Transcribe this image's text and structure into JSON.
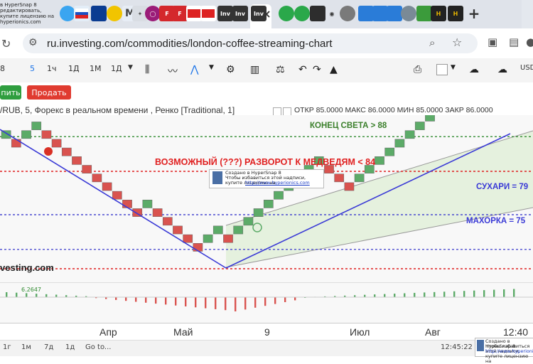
{
  "browser": {
    "hypersnap_note": [
      "в HyperSnap 8",
      "редактировать, купите лицензию на",
      "hyperionics.com"
    ],
    "tab_badges": [
      "F",
      "F",
      "Inv",
      "Inv",
      "Inv",
      "H",
      "H"
    ],
    "address": "ru.investing.com/commodities/london-coffee-streaming-chart"
  },
  "toolbar": {
    "interval_fragment": "8",
    "active_interval": "5",
    "intervals": [
      "1ч",
      "1Д",
      "1М",
      "1Д"
    ],
    "currency_fragment": "USD"
  },
  "orders": {
    "buy_label": "пить",
    "sell_label": "Продать"
  },
  "legend": {
    "title": "/RUB, 5, Форекс в реальном времени , Ренко [Traditional, 1]",
    "ohlc": "ОТКР 85.0000   МАКС 86.0000   МИН 85.0000   ЗАКР 86.0000"
  },
  "annotations": {
    "end_of_world": "КОНЕЦ СВЕТА > 88",
    "reversal": "ВОЗМОЖНЫЙ (???) РАЗВОРОТ К МЕДВЕДЯМ < 84",
    "sukhari": "СУХАРИ = 79",
    "makhorka": "МАХОРКА = 75"
  },
  "watermark": {
    "title": "Создано в HyperSnap 8",
    "line1": "Чтобы избавиться этой надписи, купите лицензию на",
    "link": "http://www.hyperionics.com",
    "logo": "vesting.com"
  },
  "oscillator": {
    "value_label": "6.2647"
  },
  "x_axis": {
    "labels": [
      "Апр",
      "Май",
      "9",
      "Июл",
      "Авг",
      "12:40"
    ]
  },
  "bottom": {
    "ranges": [
      "1г",
      "1м",
      "7д",
      "1д",
      "Go to..."
    ],
    "clock": "12:45:22 (UTC+3)"
  },
  "colors": {
    "bull": "#5cab68",
    "bear": "#d9534f",
    "trend": "#3a3ad6",
    "red_line": "#e02020",
    "blue_line": "#4a4acf",
    "green_line": "#2f8a2f"
  },
  "chart_data": {
    "type": "renko",
    "bricks": [
      "up",
      "down",
      "up",
      "up",
      "down",
      "down",
      "down",
      "down",
      "down",
      "down",
      "down",
      "down",
      "down",
      "down",
      "up",
      "down",
      "down",
      "down",
      "down",
      "down",
      "up",
      "up",
      "down",
      "up",
      "up",
      "up",
      "up",
      "up",
      "up",
      "up",
      "up",
      "up",
      "down",
      "down",
      "down",
      "up",
      "up",
      "up",
      "up",
      "up",
      "up",
      "up",
      "up",
      "up",
      "up",
      "up",
      "up"
    ],
    "levels": [
      {
        "name": "КОНЕЦ СВЕТА",
        "value": 88
      },
      {
        "name": "РАЗВОРОТ К МЕДВЕДЯМ",
        "value": 84
      },
      {
        "name": "СУХАРИ",
        "value": 79
      },
      {
        "name": "МАХОРКА",
        "value": 75
      }
    ],
    "last_close": 86.0
  }
}
